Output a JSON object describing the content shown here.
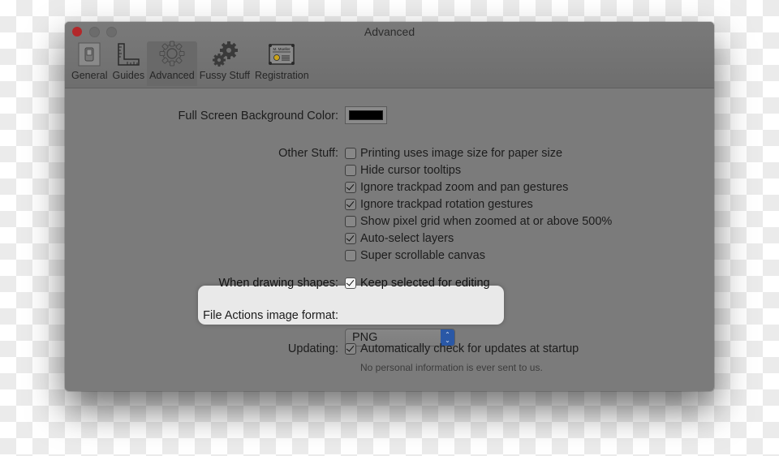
{
  "window": {
    "title": "Advanced",
    "traffic_lights": [
      "close",
      "minimize",
      "zoom"
    ]
  },
  "toolbar": {
    "tabs": [
      {
        "label": "General",
        "icon": "switch-icon",
        "active": false
      },
      {
        "label": "Guides",
        "icon": "ruler-icon",
        "active": false
      },
      {
        "label": "Advanced",
        "icon": "gear-icon",
        "active": true
      },
      {
        "label": "Fussy Stuff",
        "icon": "gears-icon",
        "active": false
      },
      {
        "label": "Registration",
        "icon": "certificate-icon",
        "active": false
      }
    ],
    "registration_card_text": "M. Mueller"
  },
  "settings": {
    "background_color": {
      "label": "Full Screen Background Color:",
      "value": "#000000"
    },
    "other_stuff": {
      "label": "Other Stuff:",
      "options": [
        {
          "label": "Printing uses image size for paper size",
          "checked": false
        },
        {
          "label": "Hide cursor tooltips",
          "checked": false
        },
        {
          "label": "Ignore trackpad zoom and pan gestures",
          "checked": true
        },
        {
          "label": "Ignore trackpad rotation gestures",
          "checked": true
        },
        {
          "label": "Show pixel grid when zoomed at or above 500%",
          "checked": false
        },
        {
          "label": "Auto-select layers",
          "checked": true
        },
        {
          "label": "Super scrollable canvas",
          "checked": false
        }
      ]
    },
    "drawing_shapes": {
      "label": "When drawing shapes:",
      "option": {
        "label": "Keep selected for editing",
        "checked": true
      },
      "highlighted": true
    },
    "file_format": {
      "label": "File Actions image format:",
      "value": "PNG"
    },
    "updating": {
      "label": "Updating:",
      "option": {
        "label": "Automatically check for updates at startup",
        "checked": true
      },
      "note": "No personal information is ever sent to us."
    }
  },
  "colors": {
    "close_button": "#b3282a",
    "popup_accent": "#2a58a6",
    "highlight_bg": "#e9e9e9"
  }
}
